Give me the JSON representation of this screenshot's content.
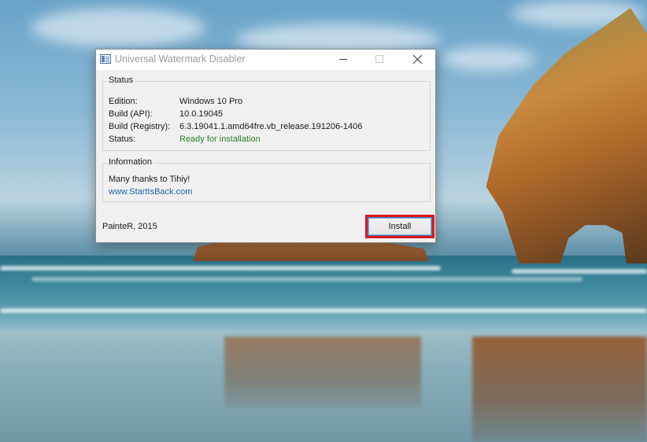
{
  "window": {
    "title": "Universal Watermark Disabler"
  },
  "status_group": {
    "legend": "Status",
    "rows": [
      {
        "label": "Edition:",
        "value": "Windows 10 Pro"
      },
      {
        "label": "Build (API):",
        "value": "10.0.19045"
      },
      {
        "label": "Build (Registry):",
        "value": "6.3.19041.1.amd64fre.vb_release.191206-1406"
      },
      {
        "label": "Status:",
        "value": "Ready for installation"
      }
    ],
    "ready_color": "#2a7f2a"
  },
  "info_group": {
    "legend": "Information",
    "message": "Many thanks to Tihiy!",
    "link": "www.StartIsBack.com"
  },
  "footer": {
    "credit": "PainteR, 2015",
    "install_label": "Install",
    "highlight_color": "#e0141c"
  },
  "icons": {
    "app": "app-window-icon",
    "minimize": "minimize-icon",
    "maximize": "maximize-icon",
    "close": "close-icon"
  }
}
